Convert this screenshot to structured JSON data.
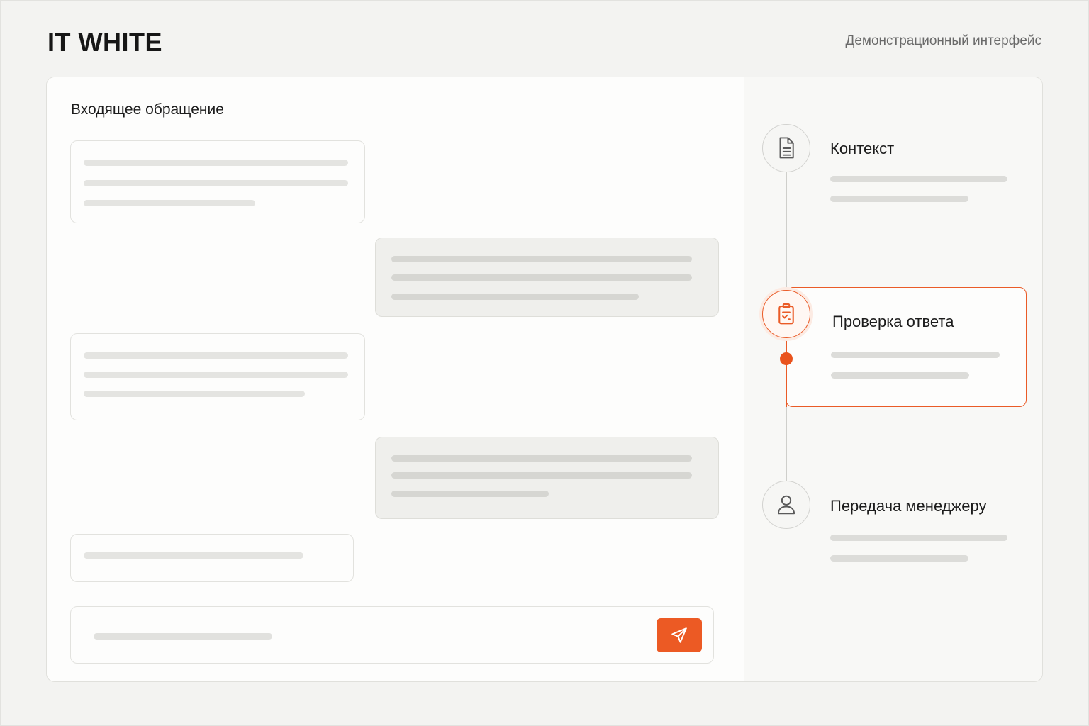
{
  "header": {
    "brand": "IT WHITE",
    "subtitle": "Демонстрационный интерфейс"
  },
  "chat": {
    "title": "Входящее обращение",
    "messages": [
      {
        "direction": "incoming",
        "lines": 3
      },
      {
        "direction": "outgoing",
        "lines": 3
      },
      {
        "direction": "incoming",
        "lines": 3
      },
      {
        "direction": "outgoing",
        "lines": 3
      },
      {
        "direction": "incoming",
        "lines": 1
      }
    ],
    "composer": {
      "send_icon": "send-icon"
    }
  },
  "steps": {
    "items": [
      {
        "label": "Контекст",
        "icon": "document-icon",
        "active": false
      },
      {
        "label": "Проверка ответа",
        "icon": "clipboard-check-icon",
        "active": true
      },
      {
        "label": "Передача менеджеру",
        "icon": "user-icon",
        "active": false
      }
    ]
  },
  "colors": {
    "accent": "#ea5b27",
    "background": "#f3f3f1",
    "panel": "#fbfbfa"
  }
}
